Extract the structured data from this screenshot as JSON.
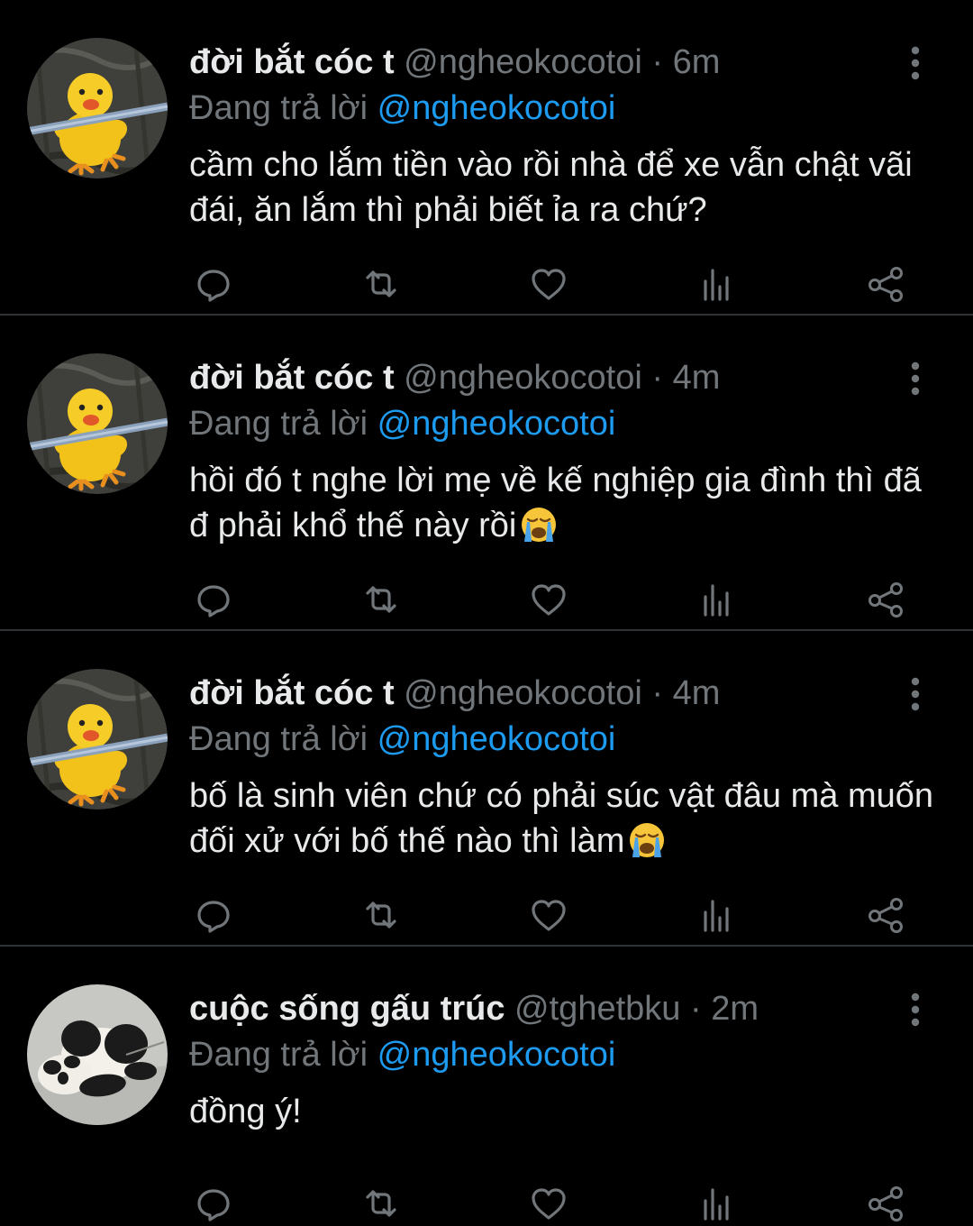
{
  "colors": {
    "background": "#000000",
    "text": "#e7e9ea",
    "muted": "#71767b",
    "accent": "#1d9bf0",
    "divider": "#2f3336"
  },
  "tweets": [
    {
      "name": "đời bắt cóc t",
      "handle": "@ngheokocotoi",
      "separator": "·",
      "time": "6m",
      "reply_prefix": "Đang trả lời",
      "reply_to": "@ngheokocotoi",
      "text": "cầm cho lắm tiền vào rồi nhà để xe vẫn chật vãi đái, ăn lắm thì phải biết ỉa ra chứ?",
      "avatar_icon": "yellow-duck-avatar"
    },
    {
      "name": "đời bắt cóc t",
      "handle": "@ngheokocotoi",
      "separator": "·",
      "time": "4m",
      "reply_prefix": "Đang trả lời",
      "reply_to": "@ngheokocotoi",
      "text": "hồi đó t nghe lời mẹ về kế nghiệp gia đình thì đã đ phải khổ thế này rồi",
      "emoji": "crying-face-emoji",
      "avatar_icon": "yellow-duck-avatar"
    },
    {
      "name": "đời bắt cóc t",
      "handle": "@ngheokocotoi",
      "separator": "·",
      "time": "4m",
      "reply_prefix": "Đang trả lời",
      "reply_to": "@ngheokocotoi",
      "text": "bố là sinh viên chứ có phải súc vật đâu mà muốn đối xử với bố thế nào thì làm",
      "emoji": "crying-face-emoji",
      "avatar_icon": "yellow-duck-avatar"
    },
    {
      "name": "cuộc sống gấu trúc",
      "handle": "@tghetbku",
      "separator": "·",
      "time": "2m",
      "reply_prefix": "Đang trả lời",
      "reply_to": "@ngheokocotoi",
      "text": "đồng ý!",
      "avatar_icon": "panda-avatar"
    }
  ],
  "action_icons": [
    "reply-icon",
    "retweet-icon",
    "like-icon",
    "views-icon",
    "share-icon"
  ]
}
